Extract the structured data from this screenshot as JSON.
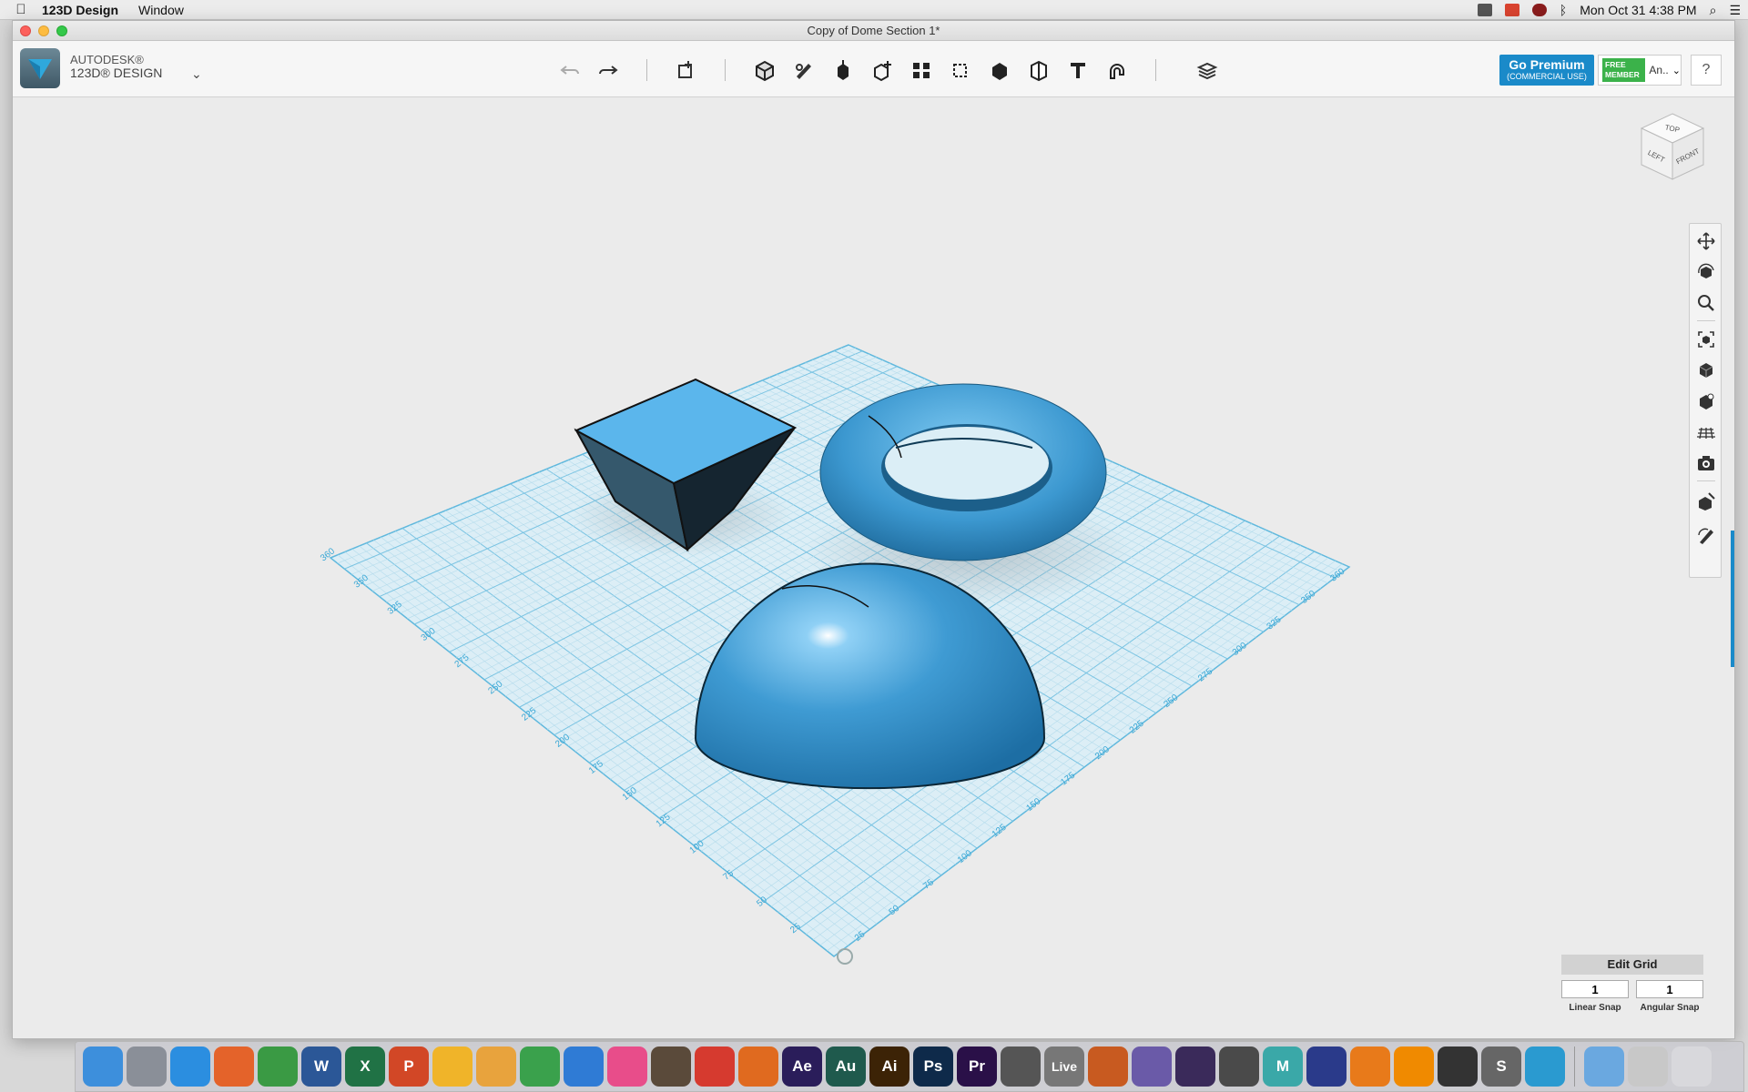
{
  "menubar": {
    "app_name": "123D Design",
    "menu_window": "Window",
    "clock": "Mon Oct 31  4:38 PM"
  },
  "window": {
    "title": "Copy of Dome Section 1*"
  },
  "branding": {
    "line1": "AUTODESK®",
    "line2": "123D® DESIGN"
  },
  "toolbar": {
    "tools": [
      "undo-icon",
      "redo-icon",
      "transform-icon",
      "primitives-icon",
      "sketch-icon",
      "construct-icon",
      "modify-icon",
      "pattern-icon",
      "grouping-icon",
      "combine-icon",
      "measure-icon",
      "text-icon",
      "snap-icon",
      "materials-icon"
    ]
  },
  "account": {
    "premium_label": "Go Premium",
    "premium_sub": "(COMMERCIAL USE)",
    "badge_line1": "FREE",
    "badge_line2": "MEMBER",
    "user_short": "An..",
    "help": "?"
  },
  "viewcube": {
    "top": "TOP",
    "left": "LEFT",
    "front": "FRONT"
  },
  "nav_tools": [
    "pan-icon",
    "orbit-icon",
    "zoom-icon",
    "fit-icon",
    "view-mode-icon",
    "visibility-icon",
    "grid-icon",
    "screenshot-icon",
    "material-icon",
    "edit-icon"
  ],
  "grid": {
    "ticks_left": [
      "360",
      "350",
      "325",
      "300",
      "275",
      "250",
      "225",
      "200",
      "175",
      "150",
      "125",
      "100",
      "75",
      "50",
      "25"
    ],
    "ticks_right": [
      "25",
      "50",
      "75",
      "100",
      "125",
      "150",
      "175",
      "200",
      "225",
      "250",
      "275",
      "300",
      "325",
      "350",
      "360"
    ]
  },
  "edit_grid": {
    "title": "Edit Grid",
    "linear_value": "1",
    "angular_value": "1",
    "linear_label": "Linear Snap",
    "angular_label": "Angular Snap"
  },
  "dock_apps": [
    {
      "name": "finder",
      "color": "#3d8fdc",
      "label": ""
    },
    {
      "name": "launchpad",
      "color": "#8a8f98",
      "label": ""
    },
    {
      "name": "safari",
      "color": "#2b8ee0",
      "label": ""
    },
    {
      "name": "firefox",
      "color": "#e4632a",
      "label": ""
    },
    {
      "name": "chrome",
      "color": "#3a9a44",
      "label": ""
    },
    {
      "name": "word",
      "color": "#2b5797",
      "label": "W"
    },
    {
      "name": "excel",
      "color": "#207245",
      "label": "X"
    },
    {
      "name": "powerpoint",
      "color": "#d24726",
      "label": "P"
    },
    {
      "name": "photos",
      "color": "#f0b429",
      "label": ""
    },
    {
      "name": "pages",
      "color": "#e8a33d",
      "label": ""
    },
    {
      "name": "numbers",
      "color": "#3aa14c",
      "label": ""
    },
    {
      "name": "keynote",
      "color": "#2f7bd5",
      "label": ""
    },
    {
      "name": "itunes",
      "color": "#e84d8a",
      "label": ""
    },
    {
      "name": "garageband",
      "color": "#5a4a3a",
      "label": ""
    },
    {
      "name": "sketchup",
      "color": "#d63a2f",
      "label": ""
    },
    {
      "name": "matlab",
      "color": "#e06a1f",
      "label": ""
    },
    {
      "name": "after-effects",
      "color": "#2a1d5a",
      "label": "Ae"
    },
    {
      "name": "audition",
      "color": "#1f5a4d",
      "label": "Au"
    },
    {
      "name": "illustrator",
      "color": "#3c2306",
      "label": "Ai"
    },
    {
      "name": "photoshop",
      "color": "#0e2a4a",
      "label": "Ps"
    },
    {
      "name": "premiere",
      "color": "#2a1048",
      "label": "Pr"
    },
    {
      "name": "final-cut",
      "color": "#555",
      "label": ""
    },
    {
      "name": "ableton-live",
      "color": "#777",
      "label": "Live"
    },
    {
      "name": "reason",
      "color": "#c85a20",
      "label": ""
    },
    {
      "name": "potion",
      "color": "#6a5aa8",
      "label": ""
    },
    {
      "name": "pro-tools",
      "color": "#3a2a5a",
      "label": ""
    },
    {
      "name": "motion",
      "color": "#4a4a4a",
      "label": ""
    },
    {
      "name": "maya",
      "color": "#3aa8a8",
      "label": "M"
    },
    {
      "name": "headphones",
      "color": "#2a3a8a",
      "label": ""
    },
    {
      "name": "audacity",
      "color": "#e87a1a",
      "label": ""
    },
    {
      "name": "vlc",
      "color": "#f08a00",
      "label": ""
    },
    {
      "name": "piano",
      "color": "#333",
      "label": ""
    },
    {
      "name": "scrivener",
      "color": "#666",
      "label": "S"
    },
    {
      "name": "123d-design",
      "color": "#2a9ad0",
      "label": ""
    },
    {
      "name": "downloads",
      "color": "#6aa8e0",
      "label": ""
    },
    {
      "name": "preview",
      "color": "#c8c8c8",
      "label": ""
    },
    {
      "name": "trash",
      "color": "#d8d8dc",
      "label": ""
    }
  ]
}
